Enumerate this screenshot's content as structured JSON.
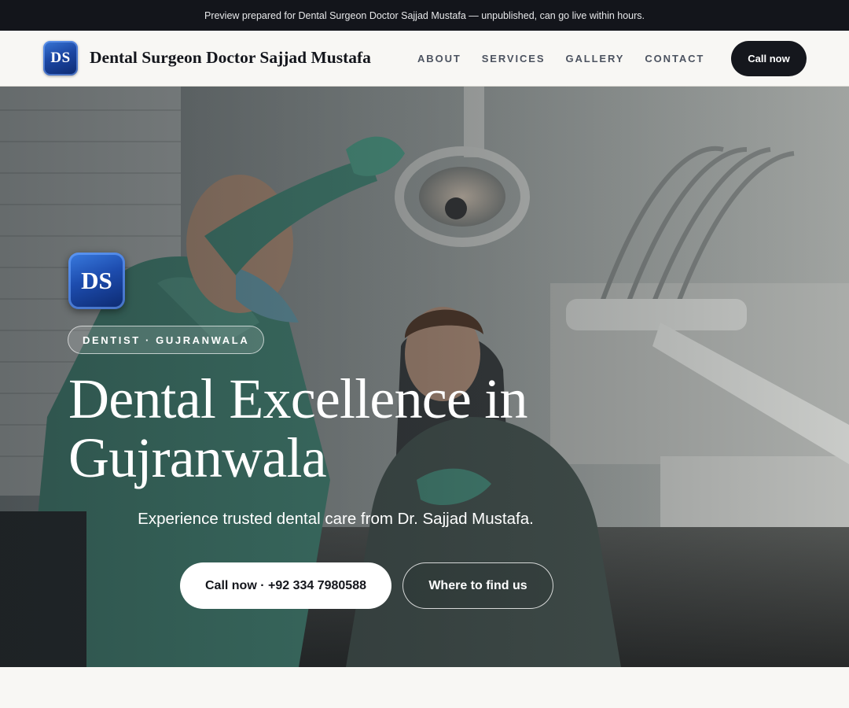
{
  "banner": {
    "text": "Preview prepared for Dental Surgeon Doctor Sajjad Mustafa — unpublished, can go live within hours."
  },
  "header": {
    "logo_initials": "DS",
    "brand_name": "Dental Surgeon Doctor Sajjad Mustafa",
    "nav": [
      {
        "label": "ABOUT"
      },
      {
        "label": "SERVICES"
      },
      {
        "label": "GALLERY"
      },
      {
        "label": "CONTACT"
      }
    ],
    "cta_label": "Call now"
  },
  "hero": {
    "logo_initials": "DS",
    "eyebrow": "DENTIST · GUJRANWALA",
    "title_line1": "Dental Excellence in",
    "title_line2": "Gujranwala",
    "subtitle": "Experience trusted dental care from Dr. Sajjad Mustafa.",
    "primary_button": "Call now · +92 334 7980588",
    "secondary_button": "Where to find us",
    "background_image": "dental-clinic-photo"
  },
  "colors": {
    "banner_bg": "#13151b",
    "header_bg": "#f8f7f4",
    "cta_bg": "#15171d",
    "logo_blue": "#1b46a3",
    "scrubs_green": "#4f9a86"
  }
}
